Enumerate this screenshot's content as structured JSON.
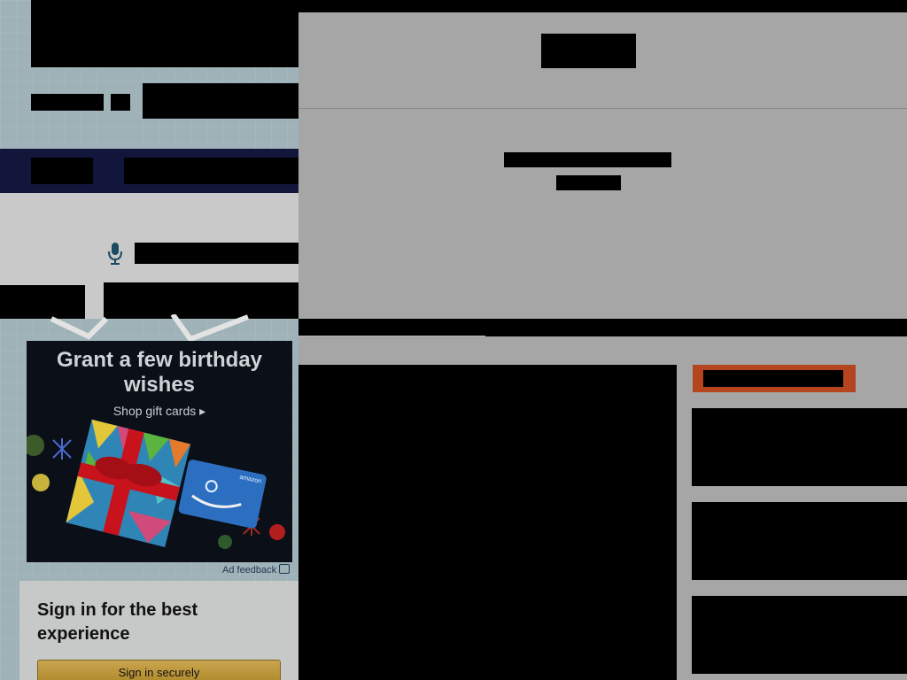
{
  "ad": {
    "title": "Grant a few birthday wishes",
    "link": "Shop gift cards ▸",
    "feedback": "Ad feedback",
    "card_brand": "amazon"
  },
  "signin": {
    "heading": "Sign in for the best experience",
    "button": "Sign in securely"
  },
  "colors": {
    "nav": "#12163a",
    "signin_button": "#c9a550",
    "action_button": "#b5451f"
  },
  "icons": [
    "microphone-icon",
    "feedback-icon"
  ]
}
